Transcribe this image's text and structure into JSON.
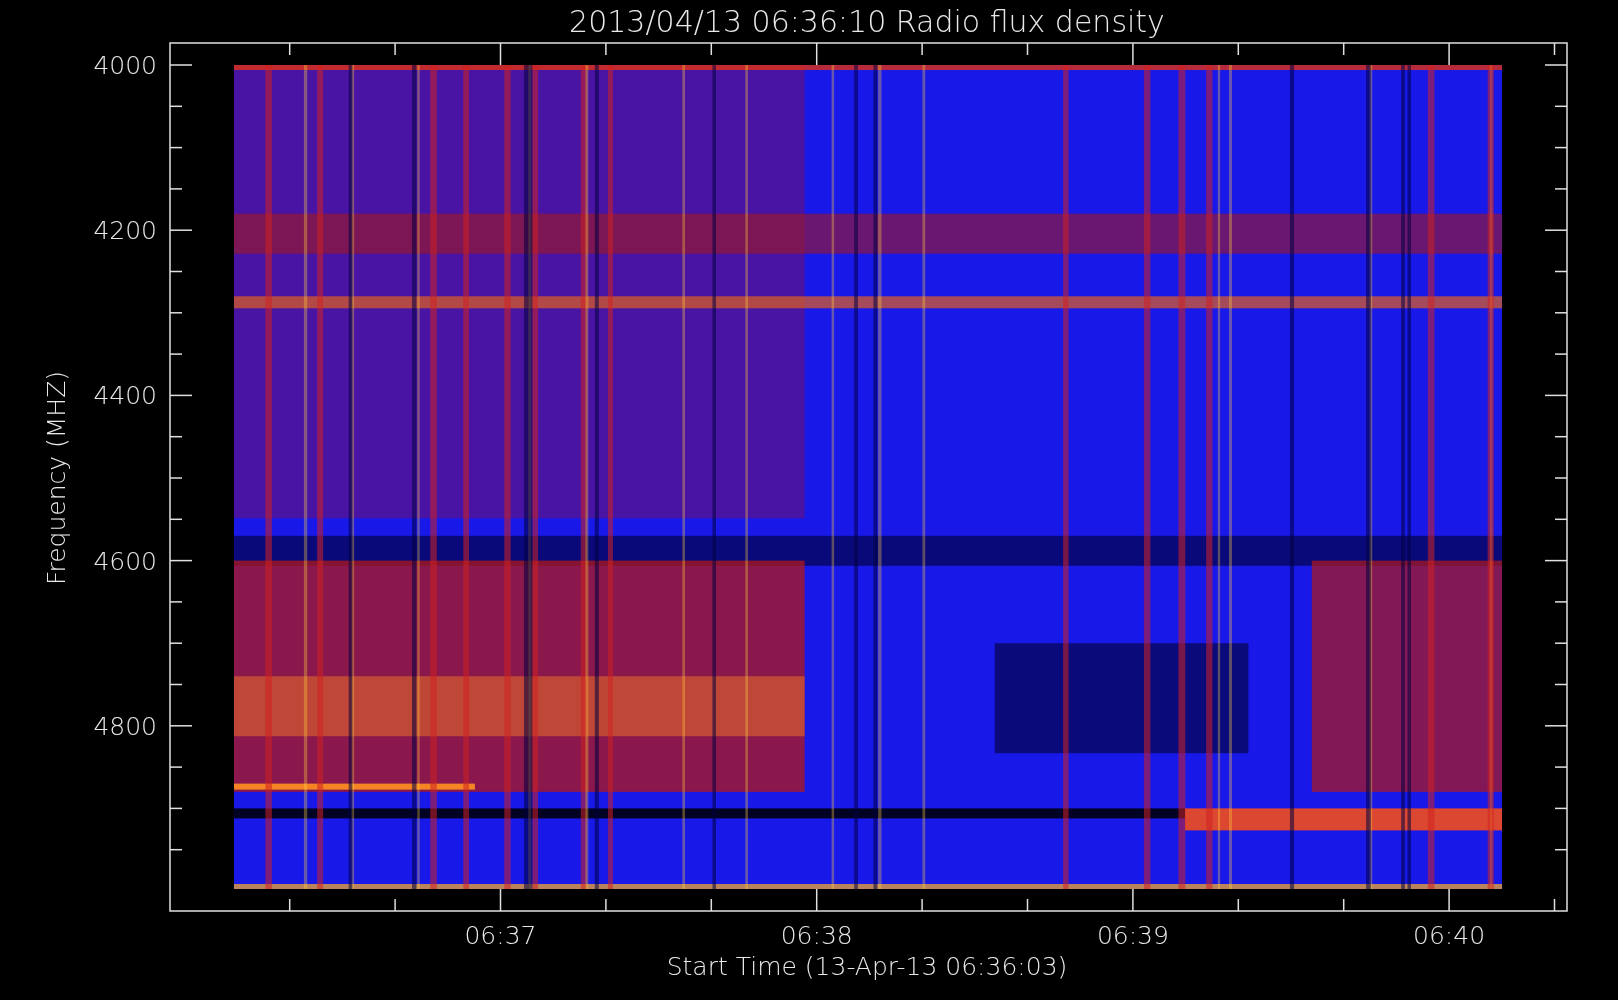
{
  "title": "2013/04/13 06:36:10 Radio flux density",
  "x_axis": {
    "label": "Start Time (13-Apr-13 06:36:03)",
    "ticks": [
      "06:37",
      "06:38",
      "06:39",
      "06:40"
    ]
  },
  "y_axis": {
    "label": "Frequency (MHZ)",
    "ticks": [
      "4000",
      "4200",
      "4400",
      "4600",
      "4800"
    ]
  }
}
